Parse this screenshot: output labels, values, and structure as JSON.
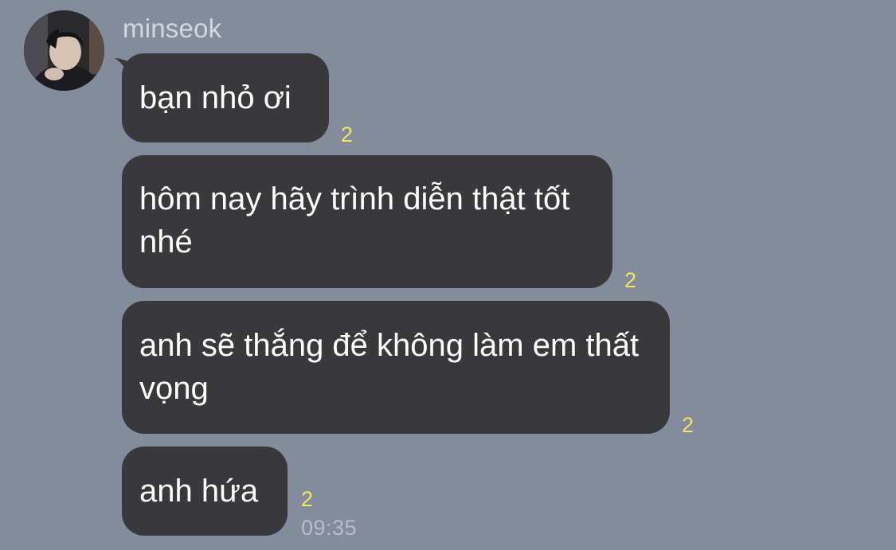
{
  "chat": {
    "sender": {
      "name": "minseok",
      "avatar_icon": "profile-photo"
    },
    "colors": {
      "background": "#848b9d",
      "bubble": "#39393b",
      "bubble_text": "#ffffff",
      "unread_count": "#f5e55a",
      "timestamp": "#b8bdc8",
      "sender_name": "#d4d7df"
    },
    "messages": [
      {
        "text": "bạn nhỏ ơi",
        "unread": "2"
      },
      {
        "text": "hôm nay hãy trình diễn thật tốt nhé",
        "unread": "2"
      },
      {
        "text": "anh sẽ thắng để không làm em thất vọng",
        "unread": "2"
      },
      {
        "text": "anh hứa",
        "unread": "2"
      }
    ],
    "last_timestamp": "09:35"
  }
}
